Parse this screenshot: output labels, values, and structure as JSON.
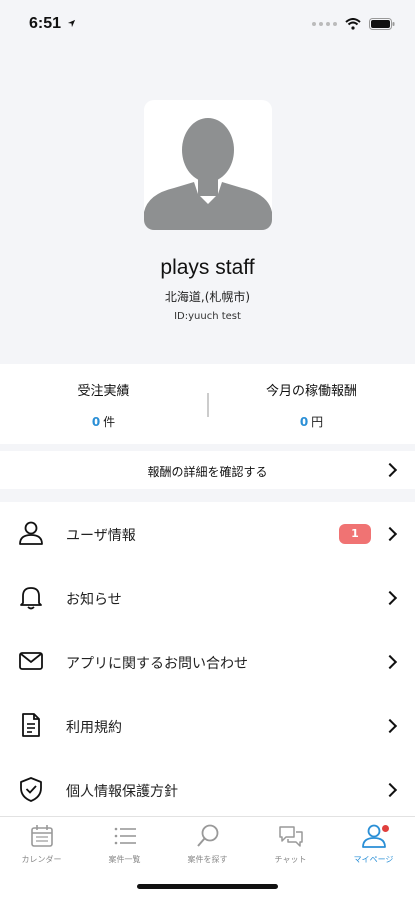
{
  "status_bar": {
    "time": "6:51"
  },
  "profile": {
    "name": "plays staff",
    "region": "北海道,(札幌市)",
    "id_text": "ID:yuuch test"
  },
  "stats": {
    "orders": {
      "label": "受注実績",
      "value": "0",
      "unit": "件"
    },
    "earnings": {
      "label": "今月の稼働報酬",
      "value": "0",
      "unit": "円"
    }
  },
  "detail_link": {
    "label": "報酬の詳細を確認する"
  },
  "menu": {
    "items": [
      {
        "label": "ユーザ情報",
        "icon": "user-icon",
        "badge": "1"
      },
      {
        "label": "お知らせ",
        "icon": "bell-icon"
      },
      {
        "label": "アプリに関するお問い合わせ",
        "icon": "mail-icon"
      },
      {
        "label": "利用規約",
        "icon": "document-icon"
      },
      {
        "label": "個人情報保護方針",
        "icon": "shield-check-icon"
      }
    ]
  },
  "tabbar": {
    "tabs": [
      {
        "label": "カレンダー",
        "icon": "calendar-icon"
      },
      {
        "label": "案件一覧",
        "icon": "list-icon"
      },
      {
        "label": "案件を探す",
        "icon": "search-icon"
      },
      {
        "label": "チャット",
        "icon": "chat-icon"
      },
      {
        "label": "マイページ",
        "icon": "profile-icon",
        "active": true
      }
    ]
  },
  "colors": {
    "accent": "#2a8fd6",
    "badge": "#f07373",
    "notification_dot": "#e0403d",
    "avatar_gray": "#8e9091"
  }
}
